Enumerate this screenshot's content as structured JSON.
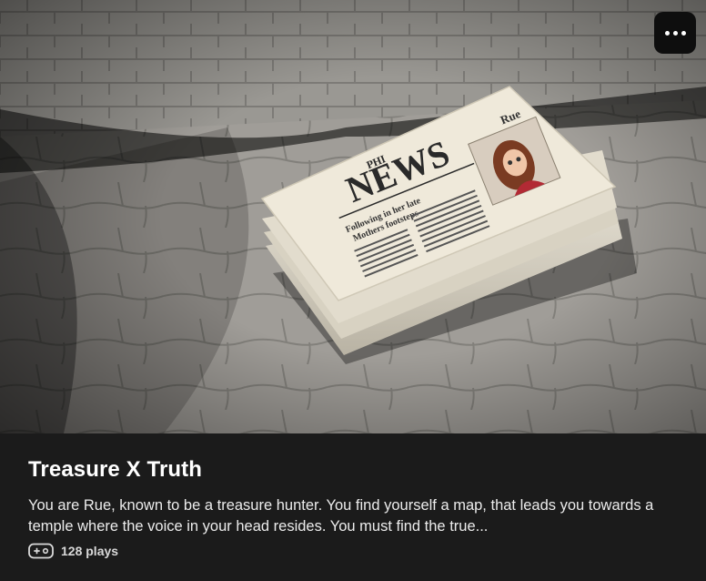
{
  "card": {
    "title": "Treasure X Truth",
    "description": "You are Rue, known to be a treasure hunter. You find yourself a map, that leads you towards a temple where the voice in your head resides. You must find the true...",
    "plays": "128 plays",
    "plays_icon": "gamepad-icon",
    "menu_icon": "more-horizontal-icon"
  },
  "cover_image": {
    "newspaper_brand": "PHI",
    "newspaper_name": "NEWS",
    "headline": [
      "Following in her late",
      "Mothers footsteps"
    ],
    "photo_caption": "Rue"
  },
  "colors": {
    "background": "#1b1b1b",
    "title": "#ffffff",
    "text": "#ececec",
    "menu_button": "#0e0e0e"
  }
}
